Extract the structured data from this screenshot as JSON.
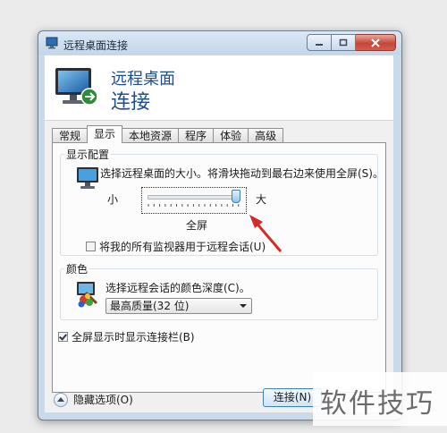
{
  "window": {
    "title": "远程桌面连接",
    "controls": {
      "minimize": "minimize-icon",
      "maximize": "maximize-icon",
      "close": "close-icon"
    }
  },
  "header": {
    "line1": "远程桌面",
    "line2": "连接"
  },
  "tabs": [
    {
      "label": "常规",
      "active": false
    },
    {
      "label": "显示",
      "active": true
    },
    {
      "label": "本地资源",
      "active": false
    },
    {
      "label": "程序",
      "active": false
    },
    {
      "label": "体验",
      "active": false
    },
    {
      "label": "高级",
      "active": false
    }
  ],
  "display_config": {
    "legend": "显示配置",
    "description": "选择远程桌面的大小。将滑块拖动到最右边来使用全屏(S)。",
    "small_label": "小",
    "large_label": "大",
    "slider_value_fraction": 1.0,
    "slider_value_text": "全屏",
    "use_all_monitors_label": "将我的所有监视器用于远程会话(U)",
    "use_all_monitors_checked": false
  },
  "colors": {
    "legend": "颜色",
    "description": "选择远程会话的颜色深度(C)。",
    "selected_depth": "最高质量(32 位)"
  },
  "connection_bar": {
    "label": "全屏显示时显示连接栏(B)",
    "checked": true
  },
  "footer": {
    "hide_options_label": "隐藏选项(O)",
    "connect_label": "连接(N)"
  },
  "annotation": {
    "arrow_color": "#d42a2a"
  },
  "watermark": {
    "text": "软件技巧"
  }
}
